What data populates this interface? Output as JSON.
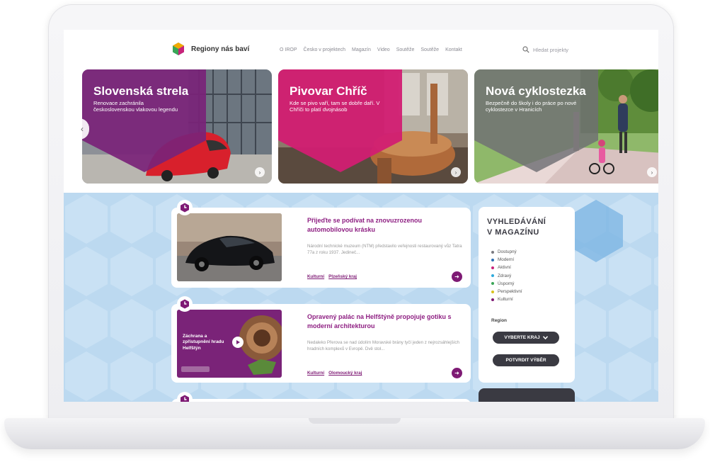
{
  "site": {
    "logo_text": "Regiony nás baví"
  },
  "nav": {
    "items": [
      "O IROP",
      "Česko v projektech",
      "Magazín",
      "Video",
      "Soutěže",
      "Soutěže",
      "Kontakt"
    ]
  },
  "search": {
    "placeholder": "Hledat projekty"
  },
  "hero": {
    "cards": [
      {
        "title": "Slovenská strela",
        "subtitle": "Renovace zachránila československou vlakovou legendu",
        "color": "#7a2378"
      },
      {
        "title": "Pivovar Chříč",
        "subtitle": "Kde se pivo vaří, tam se dobře daří. V Chříči to platí dvojnásob",
        "color": "#d21e72"
      },
      {
        "title": "Nová cyklostezka",
        "subtitle": "Bezpečně do školy i do práce po nové cyklostezce v Hranicích",
        "color": "#6f6f74"
      }
    ]
  },
  "articles": [
    {
      "title": "Přijeďte se podívat na znovuzrozenou automobilovou krásku",
      "text": "Národní technické muzeum (NTM) představilo veřejnosti restaurovaný vůz Tatra 77a z roku 1937. Jedineč...",
      "tags": [
        "Kulturní",
        "Plzeňský kraj"
      ]
    },
    {
      "title": "Opravený palác na Helfštýně propojuje gotiku s moderní architekturou",
      "text": "Nedaleko Přerova se nad údolím Moravské brány tyčí jeden z nejrozsáhlejších hradních komplexů v Evropě. Dvě stol...",
      "tags": [
        "Kulturní",
        "Olomoucký kraj"
      ],
      "video_caption": "Záchrana a zpřístupnění hradu Helfštýn"
    }
  ],
  "sidebar": {
    "title_line1": "VYHLEDÁVÁNÍ",
    "title_line2": "V MAGAZÍNU",
    "categories": [
      {
        "label": "Dostupný",
        "color": "#7a7a80"
      },
      {
        "label": "Moderní",
        "color": "#2c6fb4"
      },
      {
        "label": "Aktivní",
        "color": "#c8237a"
      },
      {
        "label": "Zdravý",
        "color": "#2eaadc"
      },
      {
        "label": "Úsporný",
        "color": "#3aa657"
      },
      {
        "label": "Perspektivní",
        "color": "#d8c21e"
      },
      {
        "label": "Kulturní",
        "color": "#7e1a74"
      }
    ],
    "region_label": "Region",
    "select_label": "VYBERTE KRAJ",
    "confirm_label": "POTVRDIT VÝBĚR"
  },
  "colors": {
    "brand_purple": "#7e1a74",
    "section_blue": "#bcd9f0",
    "dark_button": "#3a3a42"
  }
}
